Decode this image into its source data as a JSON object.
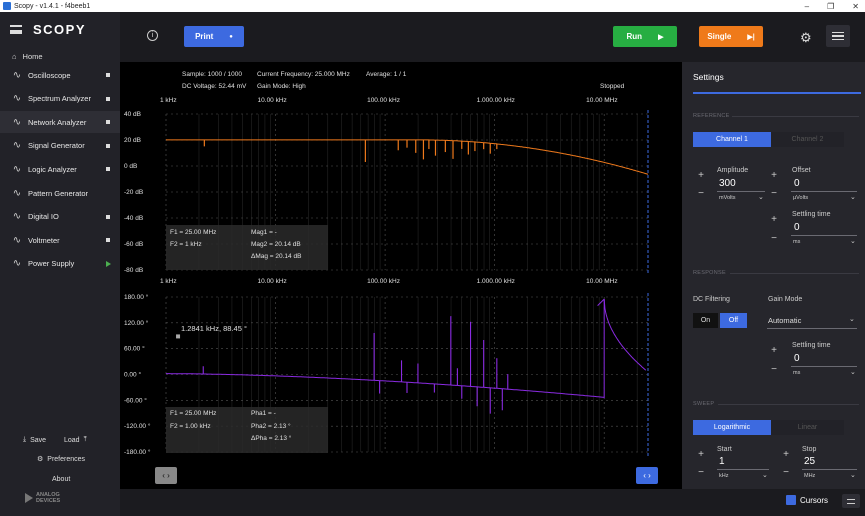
{
  "window": {
    "title": "Scopy - v1.4.1 - f4beeb1"
  },
  "app": {
    "brand": "SCOPY"
  },
  "nav": {
    "home": "Home",
    "items": [
      {
        "label": "Oscilloscope",
        "icon": "oscilloscope-icon",
        "indicator": "dot"
      },
      {
        "label": "Spectrum Analyzer",
        "icon": "spectrum-analyzer-icon",
        "indicator": "dot"
      },
      {
        "label": "Network Analyzer",
        "icon": "network-analyzer-icon",
        "indicator": "dot",
        "active": true
      },
      {
        "label": "Signal Generator",
        "icon": "signal-generator-icon",
        "indicator": "dot"
      },
      {
        "label": "Logic Analyzer",
        "icon": "logic-analyzer-icon",
        "indicator": "dot"
      },
      {
        "label": "Pattern Generator",
        "icon": "pattern-generator-icon",
        "indicator": "none"
      },
      {
        "label": "Digital IO",
        "icon": "digital-io-icon",
        "indicator": "dot"
      },
      {
        "label": "Voltmeter",
        "icon": "voltmeter-icon",
        "indicator": "dot"
      },
      {
        "label": "Power Supply",
        "icon": "power-supply-icon",
        "indicator": "play"
      }
    ],
    "save": "Save",
    "load": "Load",
    "preferences": "Preferences",
    "about": "About",
    "logo_text": "ANALOG DEVICES"
  },
  "toolbar": {
    "print": "Print",
    "run": "Run",
    "single": "Single",
    "colors": {
      "print": "#3d6ae0",
      "run": "#27ae42",
      "single": "#ef7a1a"
    }
  },
  "plot": {
    "status": {
      "sample": "Sample: 1000 / 1000",
      "current_frequency": "Current Frequency: 25.000 MHz",
      "average": "Average: 1 / 1",
      "dc_voltage": "DC Voltage: 52.44 mV",
      "gain_mode": "Gain Mode: High",
      "state": "Stopped"
    },
    "freq_ticks": [
      "1 kHz",
      "10.00 kHz",
      "100.00 kHz",
      "1.000.00 kHz",
      "10.00 MHz"
    ],
    "mag_ticks": [
      "40 dB",
      "20 dB",
      "0 dB",
      "-20 dB",
      "-40 dB",
      "-60 dB",
      "-80 dB"
    ],
    "phase_ticks": [
      "180.00 °",
      "120.00 °",
      "60.00 °",
      "0.00 °",
      "-60.00 °",
      "-120.00 °",
      "-180.00 °"
    ],
    "mag_cursor_info": {
      "f1": "F1 = 25.00 MHz",
      "f2": "F2 = 1 kHz",
      "mag1": "Mag1 = -",
      "mag2": "Mag2 = 20.14 dB",
      "dmag": "ΔMag = 20.14 dB"
    },
    "phase_cursor_info": {
      "f1": "F1 = 25.00 MHz",
      "f2": "F2 = 1.00 kHz",
      "pha1": "Pha1 = -",
      "pha2": "Pha2 = 2.13 °",
      "dpha": "ΔPha = 2.13 °"
    },
    "marker_label": "1.2841 kHz, 88.45 °",
    "colors": {
      "magnitude": "#f07a1c",
      "phase": "#8a2be2"
    }
  },
  "settings": {
    "title": "Settings",
    "reference": "REFERENCE",
    "channel1": "Channel 1",
    "channel2": "Channel 2",
    "amplitude": {
      "label": "Amplitude",
      "value": "300",
      "unit": "mVolts"
    },
    "offset": {
      "label": "Offset",
      "value": "0",
      "unit": "µVolts"
    },
    "settling_time": {
      "label": "Settling time",
      "value": "0",
      "unit": "ms"
    },
    "response": "RESPONSE",
    "dc_filtering": {
      "label": "DC Filtering",
      "on": "On",
      "off": "Off"
    },
    "gain_mode": {
      "label": "Gain Mode",
      "value": "Automatic"
    },
    "settling_time2": {
      "label": "Settling time",
      "value": "0",
      "unit": "ms"
    },
    "sweep": "SWEEP",
    "logarithmic": "Logarithmic",
    "linear": "Linear",
    "start": {
      "label": "Start",
      "value": "1",
      "unit": "kHz"
    },
    "stop": {
      "label": "Stop",
      "value": "25",
      "unit": "MHz"
    }
  },
  "bottombar": {
    "cursors": "Cursors"
  }
}
